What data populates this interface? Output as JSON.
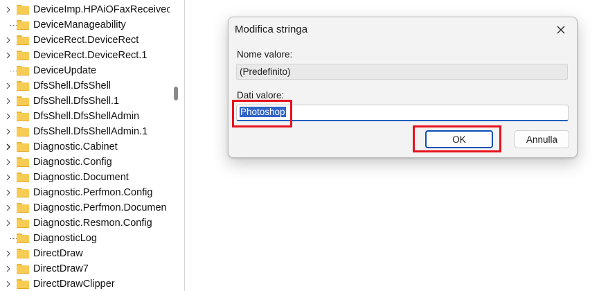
{
  "tree": {
    "items": [
      {
        "label": "DeviceImp.HPAiOFaxReceivec",
        "expandable": true
      },
      {
        "label": "DeviceManageability",
        "expandable": false
      },
      {
        "label": "DeviceRect.DeviceRect",
        "expandable": true
      },
      {
        "label": "DeviceRect.DeviceRect.1",
        "expandable": true
      },
      {
        "label": "DeviceUpdate",
        "expandable": false
      },
      {
        "label": "DfsShell.DfsShell",
        "expandable": true
      },
      {
        "label": "DfsShell.DfsShell.1",
        "expandable": true
      },
      {
        "label": "DfsShell.DfsShellAdmin",
        "expandable": true
      },
      {
        "label": "DfsShell.DfsShellAdmin.1",
        "expandable": true
      },
      {
        "label": "Diagnostic.Cabinet",
        "expandable": true
      },
      {
        "label": "Diagnostic.Config",
        "expandable": true
      },
      {
        "label": "Diagnostic.Document",
        "expandable": true
      },
      {
        "label": "Diagnostic.Perfmon.Config",
        "expandable": true
      },
      {
        "label": "Diagnostic.Perfmon.Documen",
        "expandable": true
      },
      {
        "label": "Diagnostic.Resmon.Config",
        "expandable": true
      },
      {
        "label": "DiagnosticLog",
        "expandable": false
      },
      {
        "label": "DirectDraw",
        "expandable": true
      },
      {
        "label": "DirectDraw7",
        "expandable": true
      },
      {
        "label": "DirectDrawClipper",
        "expandable": true
      }
    ]
  },
  "dialog": {
    "title": "Modifica stringa",
    "value_name_label": "Nome valore:",
    "value_name": "(Predefinito)",
    "value_data_label": "Dati valore:",
    "value_data": "Photoshop",
    "ok_label": "OK",
    "cancel_label": "Annulla"
  },
  "icons": {
    "folder": "folder-icon",
    "chevron": "chevron-right-icon",
    "close": "close-icon"
  },
  "colors": {
    "folder": "#f7cc55",
    "highlight": "#e8121c",
    "accent": "#1f5fbf",
    "selection": "#2f63c8"
  }
}
